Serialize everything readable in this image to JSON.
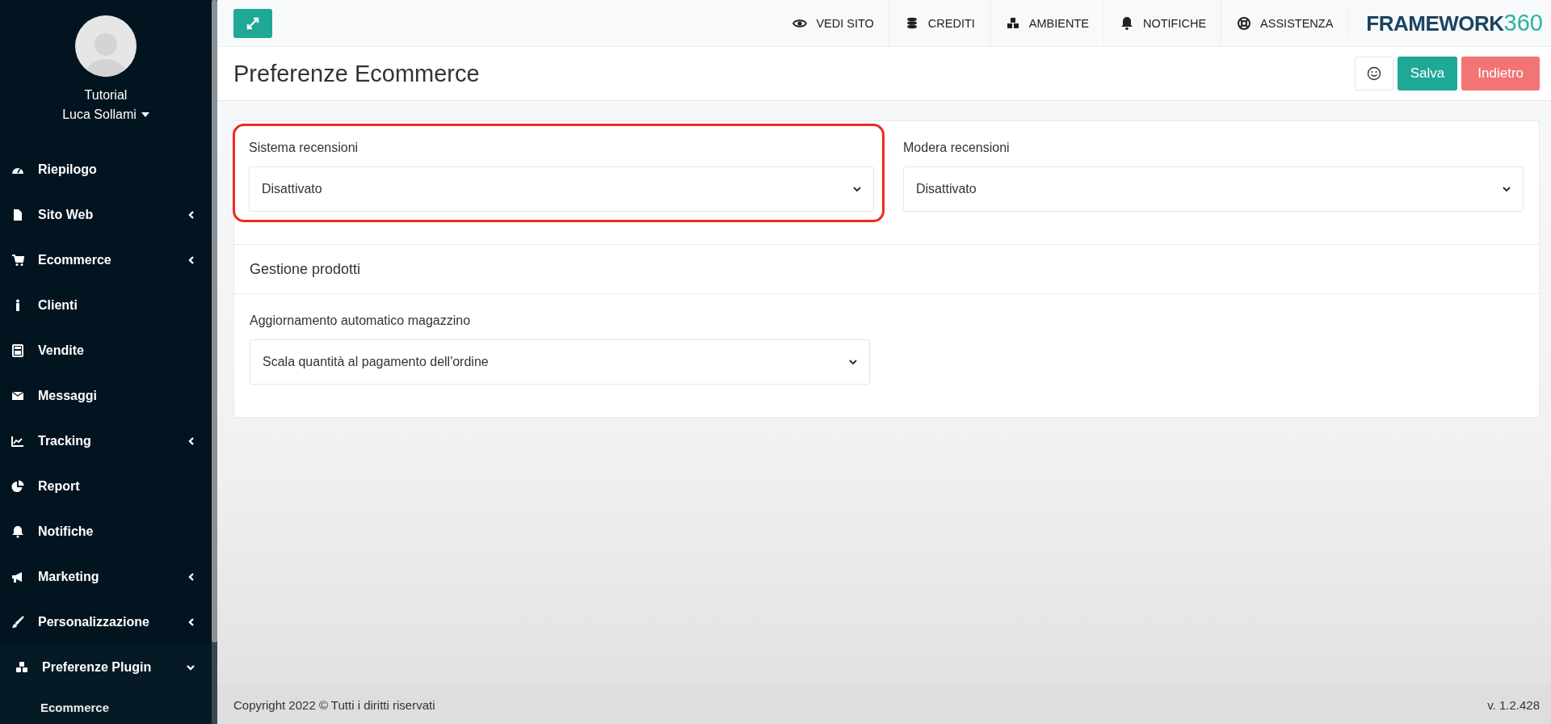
{
  "sidebar": {
    "user": {
      "line1": "Tutorial",
      "line2": "Luca Sollami"
    },
    "items": [
      {
        "label": "Riepilogo",
        "expandable": false,
        "expanded": false
      },
      {
        "label": "Sito Web",
        "expandable": true,
        "expanded": false
      },
      {
        "label": "Ecommerce",
        "expandable": true,
        "expanded": false
      },
      {
        "label": "Clienti",
        "expandable": false,
        "expanded": false
      },
      {
        "label": "Vendite",
        "expandable": false,
        "expanded": false
      },
      {
        "label": "Messaggi",
        "expandable": false,
        "expanded": false
      },
      {
        "label": "Tracking",
        "expandable": true,
        "expanded": false
      },
      {
        "label": "Report",
        "expandable": false,
        "expanded": false
      },
      {
        "label": "Notifiche",
        "expandable": false,
        "expanded": false
      },
      {
        "label": "Marketing",
        "expandable": true,
        "expanded": false
      },
      {
        "label": "Personalizzazione",
        "expandable": true,
        "expanded": false
      },
      {
        "label": "Preferenze Plugin",
        "expandable": true,
        "expanded": true,
        "children": [
          {
            "label": "Ecommerce"
          }
        ]
      }
    ]
  },
  "topbar": {
    "nav": [
      {
        "label": "VEDI SITO"
      },
      {
        "label": "CREDITI"
      },
      {
        "label": "AMBIENTE"
      },
      {
        "label": "NOTIFICHE"
      },
      {
        "label": "ASSISTENZA"
      }
    ],
    "logo": {
      "word": "FRAMEWORK",
      "number": "360"
    }
  },
  "page": {
    "title": "Preferenze Ecommerce",
    "buttons": [
      {
        "label": "Salva",
        "kind": "primary"
      },
      {
        "label": "Indietro",
        "kind": "danger"
      }
    ]
  },
  "sections": [
    {
      "fields": [
        {
          "label": "Sistema recensioni",
          "value": "Disattivato",
          "highlighted": true
        },
        {
          "label": "Modera recensioni",
          "value": "Disattivato",
          "highlighted": false
        }
      ]
    },
    {
      "heading": "Gestione prodotti",
      "fields": [
        {
          "label": "Aggiornamento automatico magazzino",
          "value": "Scala quantità al pagamento dell'ordine",
          "highlighted": false
        }
      ]
    }
  ],
  "footer": {
    "copyright": "Copyright 2022 © Tutti i diritti riservati",
    "version": "v. 1.2.428"
  }
}
